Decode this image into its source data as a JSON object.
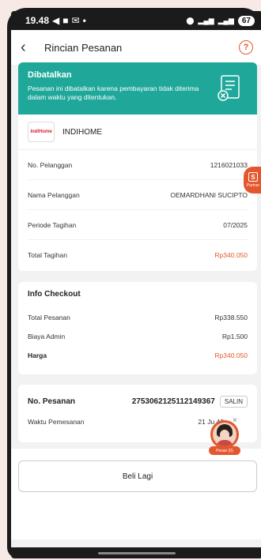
{
  "status_bar": {
    "time": "19.48",
    "battery": "67"
  },
  "header": {
    "title": "Rincian Pesanan"
  },
  "banner": {
    "title": "Dibatalkan",
    "message": "Pesanan ini dibatalkan karena pembayaran tidak diterima dalam waktu yang ditentukan."
  },
  "provider": {
    "logo_text": "IndiHome",
    "name": "INDIHOME"
  },
  "bill": {
    "rows": [
      {
        "label": "No. Pelanggan",
        "value": "1216021033"
      },
      {
        "label": "Nama Pelanggan",
        "value": "OEMARDHANI SUCIPTO"
      },
      {
        "label": "Periode Tagihan",
        "value": "07/2025"
      },
      {
        "label": "Total Tagihan",
        "value": "Rp340.050"
      }
    ]
  },
  "checkout": {
    "title": "Info Checkout",
    "rows": [
      {
        "label": "Total Pesanan",
        "value": "Rp338.550"
      },
      {
        "label": "Biaya Admin",
        "value": "Rp1.500"
      },
      {
        "label": "Harga",
        "value": "Rp340.050"
      }
    ]
  },
  "order": {
    "number_label": "No. Pesanan",
    "number_value": "2753062125112149367",
    "copy_label": "SALIN",
    "time_label": "Waktu Pemesanan",
    "time_value": "21 Ju   42"
  },
  "footer": {
    "button_label": "Beli Lagi"
  },
  "floating": {
    "partner_label": "Partner",
    "partner_icon": "S",
    "promo_label": "Pesan (0)"
  },
  "colors": {
    "teal": "#1fa89a",
    "accent": "#e4572e"
  }
}
